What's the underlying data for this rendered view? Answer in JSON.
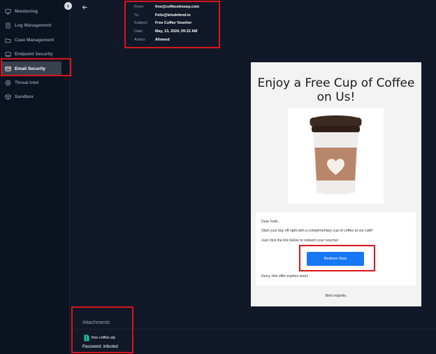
{
  "sidebar": {
    "items": [
      {
        "label": "Monitoring",
        "icon": "monitor-icon"
      },
      {
        "label": "Log Management",
        "icon": "document-icon"
      },
      {
        "label": "Case Management",
        "icon": "folder-icon"
      },
      {
        "label": "Endpoint Security",
        "icon": "device-icon"
      },
      {
        "label": "Email Security",
        "icon": "envelope-icon",
        "active": true
      },
      {
        "label": "Threat Intel",
        "icon": "target-icon"
      },
      {
        "label": "Sandbox",
        "icon": "box-icon"
      }
    ]
  },
  "email_meta": {
    "from_label": "From:",
    "from": "free@coffeeshooop.com",
    "to_label": "To:",
    "to": "Felix@letsdefend.io",
    "subject_label": "Subject:",
    "subject": "Free Coffee Voucher",
    "date_label": "Date:",
    "date": "May, 13, 2024, 09:22 AM",
    "action_label": "Action:",
    "action": "Allowed"
  },
  "email_body": {
    "headline": "Enjoy a Free Cup of Coffee on Us!",
    "greeting": "Dear Felix,",
    "line1": "Start your day off right with a complimentary cup of coffee at our café!",
    "line2": "Just click the link below to redeem your voucher.",
    "button_label": "Redeem Now",
    "closing": "Hurry, this offer expires soon!",
    "regards": "Best regards,"
  },
  "attachments": {
    "title": "Attachments",
    "file_name": "free-coffee.zip",
    "password": "Password: infected"
  },
  "colors": {
    "accent": "#1877f2",
    "annotation": "#d9141c",
    "sidebar_bg": "#0b1220",
    "main_bg": "#111827"
  }
}
